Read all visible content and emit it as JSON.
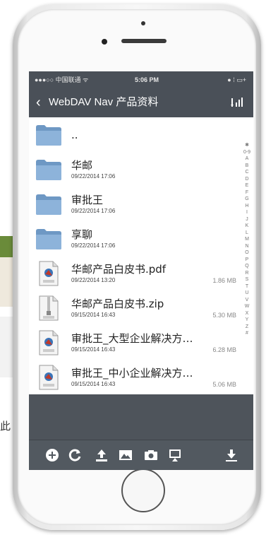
{
  "status_bar": {
    "carrier": "●●●○○ 中国联通 ᯤ",
    "time": "5:06 PM",
    "right": "● ⁞ ▭+"
  },
  "nav": {
    "back_label": "WebDAV Nav",
    "title": "产品资料"
  },
  "files": [
    {
      "name": "..",
      "date": "",
      "size": "",
      "type": "folder"
    },
    {
      "name": "华邮",
      "date": "09/22/2014 17:06",
      "size": "",
      "type": "folder"
    },
    {
      "name": "审批王",
      "date": "09/22/2014 17:06",
      "size": "",
      "type": "folder"
    },
    {
      "name": "享聊",
      "date": "09/22/2014 17:06",
      "size": "",
      "type": "folder"
    },
    {
      "name": "华邮产品白皮书.pdf",
      "date": "09/22/2014 13:20",
      "size": "1.86 MB",
      "type": "pdf"
    },
    {
      "name": "华邮产品白皮书.zip",
      "date": "09/15/2014 16:43",
      "size": "5.30 MB",
      "type": "zip"
    },
    {
      "name": "审批王_大型企业解决方…",
      "date": "09/15/2014 16:43",
      "size": "6.28 MB",
      "type": "pdf"
    },
    {
      "name": "审批王_中小企业解决方…",
      "date": "09/15/2014 16:43",
      "size": "5.06 MB",
      "type": "pdf"
    }
  ],
  "index_letters": [
    "✱",
    "0-9",
    "A",
    "B",
    "C",
    "D",
    "E",
    "F",
    "G",
    "H",
    "I",
    "J",
    "K",
    "L",
    "M",
    "N",
    "O",
    "P",
    "Q",
    "R",
    "S",
    "T",
    "U",
    "V",
    "W",
    "X",
    "Y",
    "Z",
    "#"
  ],
  "toolbar": {
    "icons": [
      "add-icon",
      "refresh-icon",
      "upload-icon",
      "photo-library-icon",
      "camera-icon",
      "screen-share-icon",
      "download-icon"
    ]
  },
  "background": {
    "side_text": "此"
  },
  "colors": {
    "screen_bg": "#4a5058",
    "folder": "#7fa6cf",
    "accent_green": "#6a8b3a"
  }
}
